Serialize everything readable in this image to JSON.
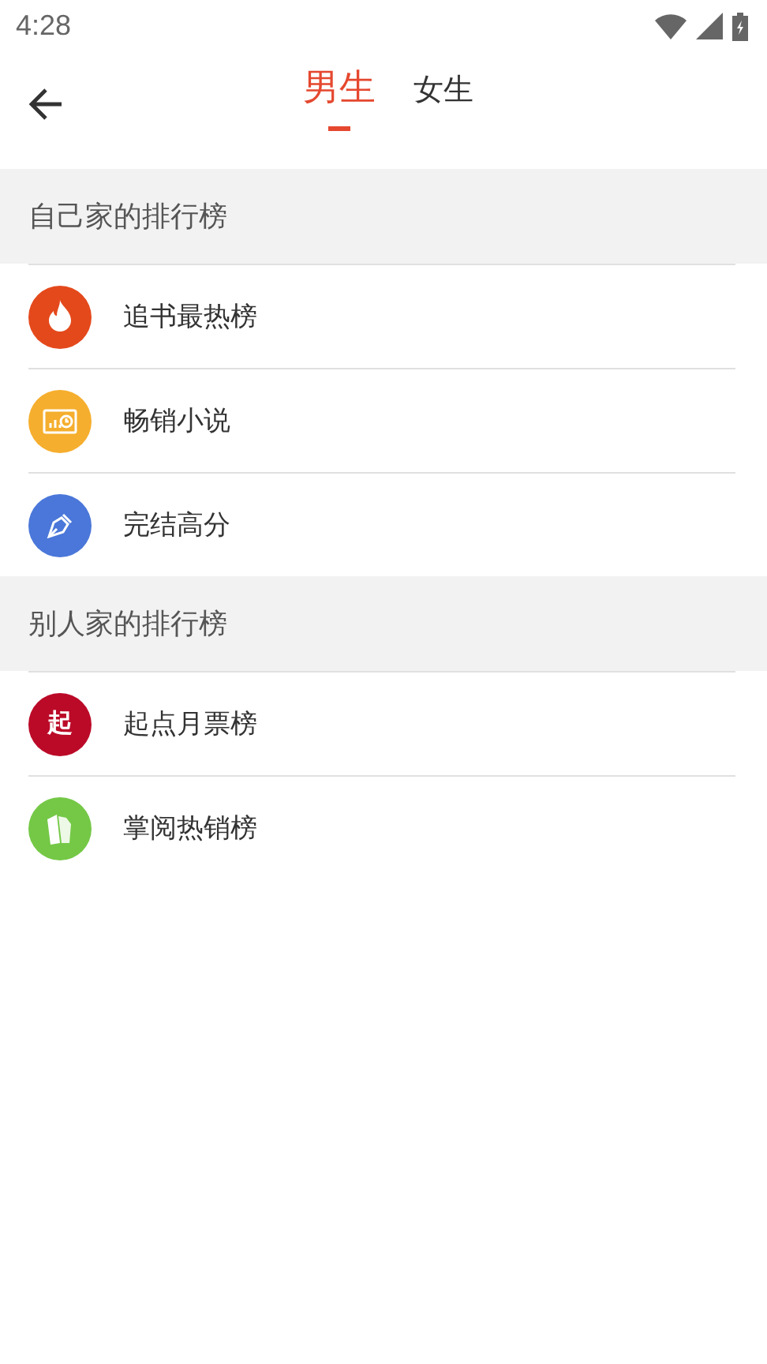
{
  "status_bar": {
    "time": "4:28"
  },
  "tabs": [
    {
      "label": "男生",
      "selected": true
    },
    {
      "label": "女生",
      "selected": false
    }
  ],
  "sections": [
    {
      "title": "自己家的排行榜",
      "items": [
        {
          "label": "追书最热榜",
          "kind": "flame",
          "color": "#e4491c"
        },
        {
          "label": "畅销小说",
          "kind": "chart",
          "color": "#f5ae2d"
        },
        {
          "label": "完结高分",
          "kind": "pen",
          "color": "#4a77d9"
        }
      ]
    },
    {
      "title": "别人家的排行榜",
      "items": [
        {
          "label": "起点月票榜",
          "kind": "glyph",
          "glyph": "起",
          "color": "#bb0a28"
        },
        {
          "label": "掌阅热销榜",
          "kind": "pages",
          "color": "#74c846"
        }
      ]
    }
  ]
}
